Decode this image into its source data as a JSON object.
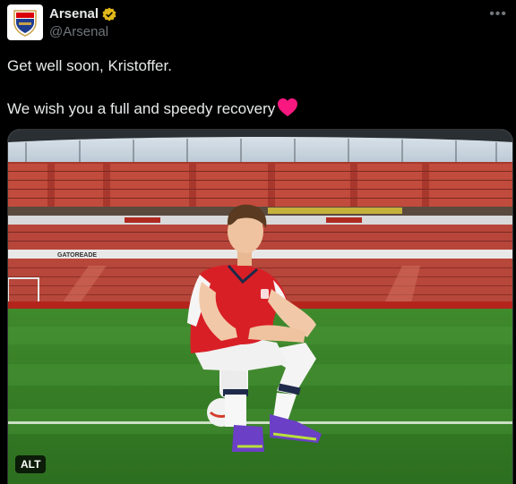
{
  "author": {
    "display_name": "Arsenal",
    "handle": "@Arsenal",
    "verified_icon": "gold-verified-badge-icon",
    "avatar_icon": "arsenal-crest-icon"
  },
  "more_icon": "more-horizontal-icon",
  "tweet": {
    "line1": "Get well soon, Kristoffer.",
    "line2": "We wish you a full and speedy recovery",
    "emoji": "red-heart-icon"
  },
  "media": {
    "badge_label": "ALT",
    "stadium_band_text": "GATOREADE"
  },
  "colors": {
    "background": "#000000",
    "text": "#e7e9ea",
    "secondary_text": "#71767b",
    "verified_gold": "#e2b719",
    "heart": "#f91880",
    "arsenal_red": "#db0007"
  }
}
